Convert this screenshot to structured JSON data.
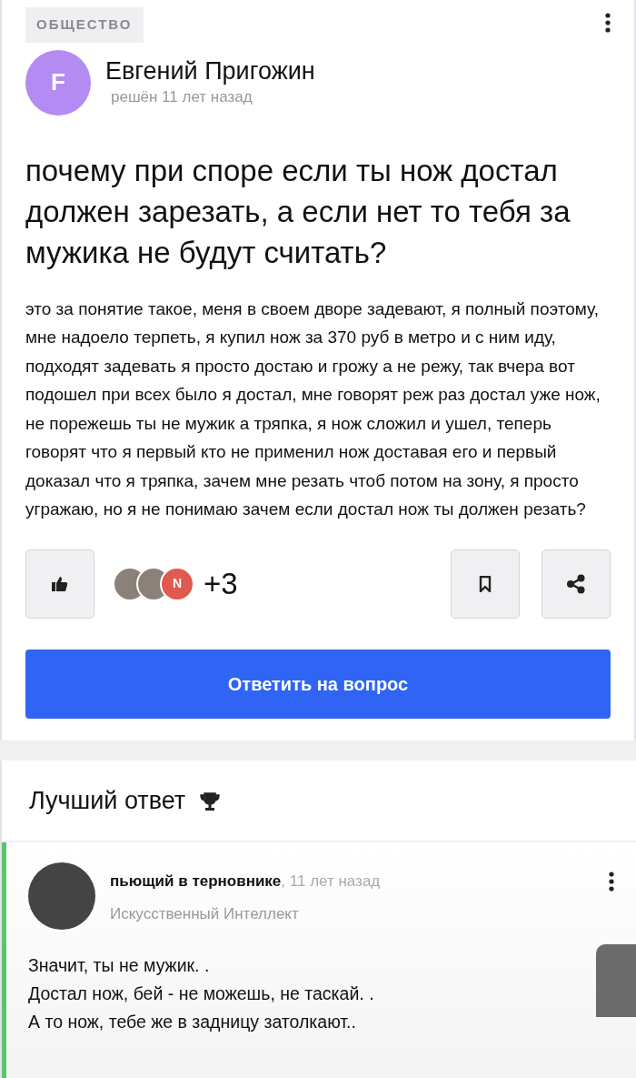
{
  "question": {
    "category": "ОБЩЕСТВО",
    "author": {
      "name": "Евгений Пригожин",
      "initial": "F",
      "status": "решён 11 лет назад"
    },
    "title": "почему при споре если ты нож достал должен зарезать, а если нет то тебя за мужика не будут считать?",
    "body": "это за понятие такое, меня в своем дворе задевают, я полный поэтому, мне надоело терпеть, я купил нож за 370 руб в метро и с ним иду, подходят задевать я просто достаю и грожу а не режу, так вчера вот подошел при всех было я достал, мне говорят реж раз достал уже нож, не порежешь ты не мужик а тряпка, я нож сложил и ушел, теперь говорят что я первый кто не применил нож доставая его и первый доказал что я тряпка, зачем мне резать чтоб потом на зону, я просто угражаю, но я не понимаю зачем если достал нож ты должен резать?",
    "voters": [
      {
        "kind": "photo"
      },
      {
        "kind": "photo"
      },
      {
        "kind": "letter",
        "letter": "N"
      }
    ],
    "more_voters": "+3",
    "answer_button": "Ответить на вопрос"
  },
  "best_answer": {
    "heading": "Лучший ответ",
    "author": "пьющий в терновнике",
    "time": ", 11 лет назад",
    "rank": "Искусственный Интеллект",
    "lines": [
      "Значит, ты не мужик. .",
      "Достал нож, бей - не можешь, не таскай. .",
      "А то нож, тебе же в задницу затолкают.."
    ]
  }
}
